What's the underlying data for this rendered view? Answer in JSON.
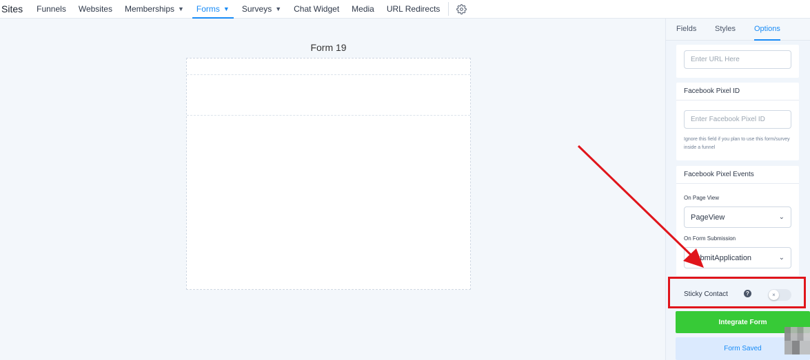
{
  "topnav": {
    "brand": "Sites",
    "items": [
      {
        "label": "Funnels"
      },
      {
        "label": "Websites"
      },
      {
        "label": "Memberships"
      },
      {
        "label": "Forms"
      },
      {
        "label": "Surveys"
      },
      {
        "label": "Chat Widget"
      },
      {
        "label": "Media"
      },
      {
        "label": "URL Redirects"
      }
    ],
    "active": "Forms"
  },
  "canvas": {
    "form_title": "Form 19"
  },
  "panel": {
    "tabs": [
      {
        "label": "Fields"
      },
      {
        "label": "Styles"
      },
      {
        "label": "Options"
      }
    ],
    "active_tab": "Options",
    "url_input": {
      "placeholder": "Enter URL Here"
    },
    "fb_pixel_id": {
      "title": "Facebook Pixel ID",
      "placeholder": "Enter Facebook Pixel ID",
      "hint": "Ignore this field if you plan to use this form/survey inside a funnel"
    },
    "fb_pixel_events": {
      "title": "Facebook Pixel Events",
      "on_page_view_label": "On Page View",
      "on_page_view_value": "PageView",
      "on_form_submission_label": "On Form Submission",
      "on_form_submission_value": "SubmitApplication"
    },
    "sticky_contact": {
      "label": "Sticky Contact",
      "enabled": false
    },
    "integrate_button": "Integrate Form",
    "saved_button": "Form Saved"
  },
  "colors": {
    "accent": "#188bf6",
    "success": "#37ca37",
    "annotation": "#e0151b"
  }
}
